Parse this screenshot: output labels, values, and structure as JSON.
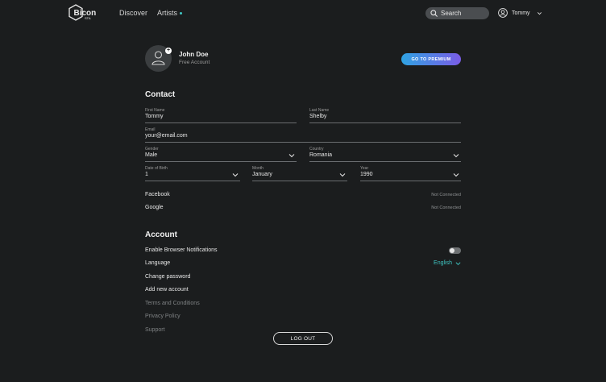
{
  "header": {
    "logo_text": "Bicon",
    "logo_sub": "STA",
    "nav": [
      {
        "label": "Discover"
      },
      {
        "label": "Artists"
      }
    ],
    "search_placeholder": "Search",
    "user_name": "Tommy"
  },
  "profile": {
    "name": "John Doe",
    "plan": "Free Account",
    "premium_label": "GO TO PREMIUM",
    "add_symbol": "+"
  },
  "contact": {
    "title": "Contact",
    "first_name": {
      "label": "First Name",
      "value": "Tommy"
    },
    "last_name": {
      "label": "Last Name",
      "value": "Shelby"
    },
    "email": {
      "label": "Email",
      "value": "your@email.com"
    },
    "gender": {
      "label": "Gender",
      "value": "Male"
    },
    "country": {
      "label": "Country",
      "value": "Romania"
    },
    "dob_day": {
      "label": "Date of Birth",
      "value": "1"
    },
    "dob_month": {
      "label": "Month",
      "value": "January"
    },
    "dob_year": {
      "label": "Year",
      "value": "1990"
    },
    "facebook": {
      "label": "Facebook",
      "status": "Not Connected"
    },
    "google": {
      "label": "Google",
      "status": "Not Connected"
    }
  },
  "account": {
    "title": "Account",
    "notifications_label": "Enable Browser Notifications",
    "notifications_enabled": false,
    "language_label": "Language",
    "language_value": "English",
    "change_password": "Change password",
    "add_account": "Add new account",
    "terms": "Terms and Conditions",
    "privacy": "Privacy Policy",
    "support": "Support",
    "logout_label": "LOG OUT"
  },
  "colors": {
    "background": "#1b1d1e",
    "accent": "#3fc7c4",
    "premium_gradient_start": "#2fa3e3",
    "premium_gradient_end": "#7a5ce6"
  }
}
